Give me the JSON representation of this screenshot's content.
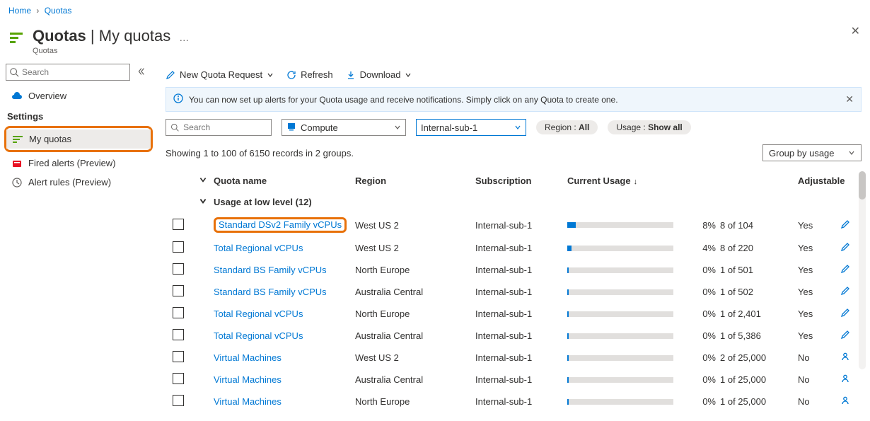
{
  "breadcrumb": {
    "home": "Home",
    "current": "Quotas"
  },
  "header": {
    "title": "Quotas",
    "page": "My quotas",
    "subtitle": "Quotas"
  },
  "sidebar": {
    "search_placeholder": "Search",
    "overview": "Overview",
    "section": "Settings",
    "my_quotas": "My quotas",
    "fired_alerts": "Fired alerts (Preview)",
    "alert_rules": "Alert rules (Preview)"
  },
  "toolbar": {
    "new_quota": "New Quota Request",
    "refresh": "Refresh",
    "download": "Download"
  },
  "banner": {
    "text": "You can now set up alerts for your Quota usage and receive notifications. Simply click on any Quota to create one."
  },
  "filters": {
    "search_placeholder": "Search",
    "provider": "Compute",
    "subscription": "Internal-sub-1",
    "region_label": "Region : ",
    "region_value": "All",
    "usage_label": "Usage : ",
    "usage_value": "Show all"
  },
  "records_text": "Showing 1 to 100 of 6150 records in 2 groups.",
  "groupby": "Group by usage",
  "columns": {
    "quota_name": "Quota name",
    "region": "Region",
    "subscription": "Subscription",
    "current_usage": "Current Usage",
    "adjustable": "Adjustable"
  },
  "group_header": "Usage at low level (12)",
  "rows": [
    {
      "name": "Standard DSv2 Family vCPUs",
      "region": "West US 2",
      "sub": "Internal-sub-1",
      "pct": "8%",
      "pct_num": 8,
      "usage": "8 of 104",
      "adj": "Yes",
      "adj_type": "pencil",
      "highlight": true
    },
    {
      "name": "Total Regional vCPUs",
      "region": "West US 2",
      "sub": "Internal-sub-1",
      "pct": "4%",
      "pct_num": 4,
      "usage": "8 of 220",
      "adj": "Yes",
      "adj_type": "pencil"
    },
    {
      "name": "Standard BS Family vCPUs",
      "region": "North Europe",
      "sub": "Internal-sub-1",
      "pct": "0%",
      "pct_num": 0,
      "usage": "1 of 501",
      "adj": "Yes",
      "adj_type": "pencil"
    },
    {
      "name": "Standard BS Family vCPUs",
      "region": "Australia Central",
      "sub": "Internal-sub-1",
      "pct": "0%",
      "pct_num": 0,
      "usage": "1 of 502",
      "adj": "Yes",
      "adj_type": "pencil"
    },
    {
      "name": "Total Regional vCPUs",
      "region": "North Europe",
      "sub": "Internal-sub-1",
      "pct": "0%",
      "pct_num": 0,
      "usage": "1 of 2,401",
      "adj": "Yes",
      "adj_type": "pencil"
    },
    {
      "name": "Total Regional vCPUs",
      "region": "Australia Central",
      "sub": "Internal-sub-1",
      "pct": "0%",
      "pct_num": 0,
      "usage": "1 of 5,386",
      "adj": "Yes",
      "adj_type": "pencil"
    },
    {
      "name": "Virtual Machines",
      "region": "West US 2",
      "sub": "Internal-sub-1",
      "pct": "0%",
      "pct_num": 0,
      "usage": "2 of 25,000",
      "adj": "No",
      "adj_type": "person"
    },
    {
      "name": "Virtual Machines",
      "region": "Australia Central",
      "sub": "Internal-sub-1",
      "pct": "0%",
      "pct_num": 0,
      "usage": "1 of 25,000",
      "adj": "No",
      "adj_type": "person"
    },
    {
      "name": "Virtual Machines",
      "region": "North Europe",
      "sub": "Internal-sub-1",
      "pct": "0%",
      "pct_num": 0,
      "usage": "1 of 25,000",
      "adj": "No",
      "adj_type": "person"
    }
  ]
}
